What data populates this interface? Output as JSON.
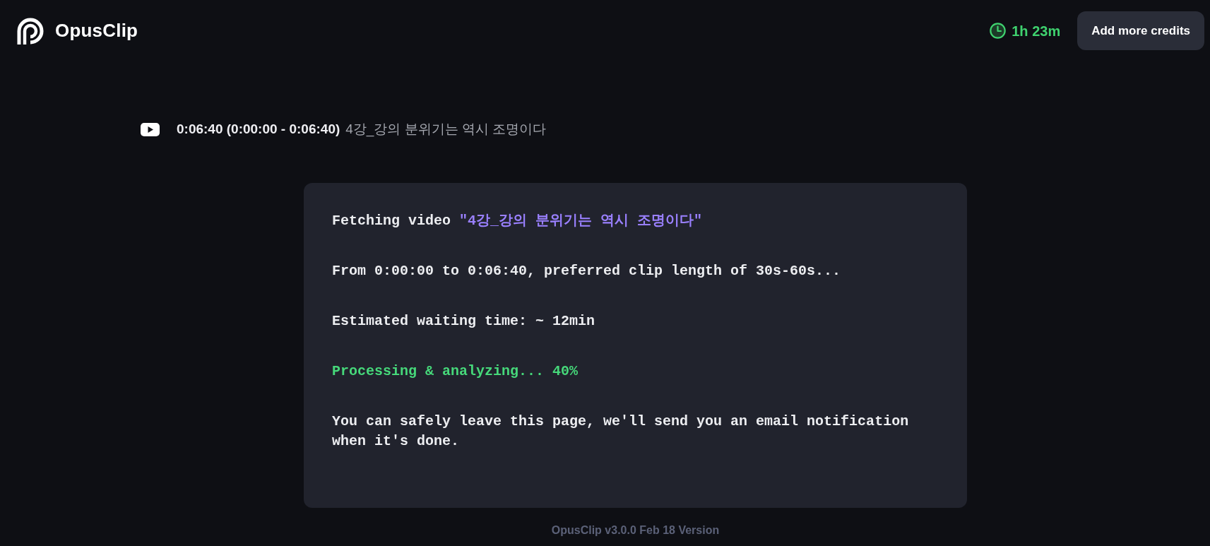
{
  "header": {
    "logo_text": "OpusClip",
    "credits_time": "1h 23m",
    "add_credits_button": "Add more credits"
  },
  "video": {
    "duration": "0:06:40 (0:00:00 - 0:06:40)",
    "title": "4강_강의 분위기는 역시 조명이다"
  },
  "status_card": {
    "lines": [
      {
        "kind": "fetch",
        "text": "Fetching video",
        "highlight": "\"4강_강의 분위기는 역시 조명이다\""
      },
      {
        "kind": "info",
        "text": "From 0:00:00 to 0:06:40, preferred clip length of 30s-60s..."
      },
      {
        "kind": "info",
        "text": "Estimated waiting time: ~ 12min"
      },
      {
        "kind": "progress",
        "text": "Processing & analyzing... 40%"
      },
      {
        "kind": "info",
        "text": "You can safely leave this page, we'll send you an email notification when it's done."
      }
    ]
  },
  "footer": {
    "version": "OpusClip v3.0.0 Feb 18 Version"
  }
}
